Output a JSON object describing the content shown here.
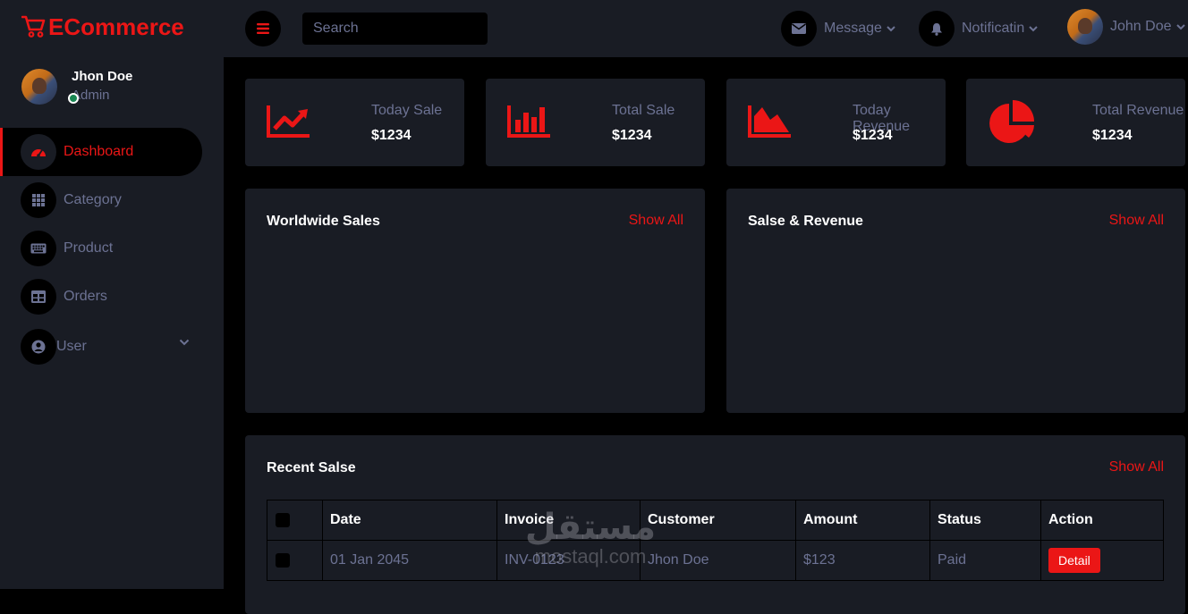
{
  "brand": {
    "name": "ECommerce",
    "accent": "#eb1616",
    "panel_bg": "#191c24",
    "page_bg": "#000000",
    "muted": "#6c7293"
  },
  "profile": {
    "name": "Jhon Doe",
    "role": "Admin",
    "status_color": "#198754"
  },
  "nav": {
    "items": [
      {
        "label": "Dashboard",
        "icon": "tachometer-icon",
        "active": true
      },
      {
        "label": "Category",
        "icon": "grid-icon"
      },
      {
        "label": "Product",
        "icon": "keyboard-icon"
      },
      {
        "label": "Orders",
        "icon": "table-icon"
      },
      {
        "label": "User",
        "icon": "user-circle-icon",
        "has_dropdown": true
      }
    ]
  },
  "topbar": {
    "search_placeholder": "Search",
    "message_label": "Message",
    "notification_label": "Notificatin",
    "user_label": "John Doe"
  },
  "stats": [
    {
      "label": "Today Sale",
      "value": "$1234",
      "icon": "chart-line-icon"
    },
    {
      "label": "Total Sale",
      "value": "$1234",
      "icon": "chart-bar-icon"
    },
    {
      "label": "Today Revenue",
      "value": "$1234",
      "icon": "chart-area-icon"
    },
    {
      "label": "Total Revenue",
      "value": "$1234",
      "icon": "chart-pie-icon"
    }
  ],
  "panels": {
    "worldwide": {
      "title": "Worldwide Sales",
      "link": "Show All"
    },
    "sales_revenue": {
      "title": "Salse & Revenue",
      "link": "Show All"
    },
    "recent": {
      "title": "Recent Salse",
      "link": "Show All"
    }
  },
  "table": {
    "headers": [
      "Date",
      "Invoice",
      "Customer",
      "Amount",
      "Status",
      "Action"
    ],
    "rows": [
      {
        "date": "01 Jan 2045",
        "invoice": "INV-0123",
        "customer": "Jhon Doe",
        "amount": "$123",
        "status": "Paid",
        "action": "Detail"
      }
    ]
  },
  "watermark": {
    "arabic": "مستقل",
    "latin": "mostaql.com"
  }
}
